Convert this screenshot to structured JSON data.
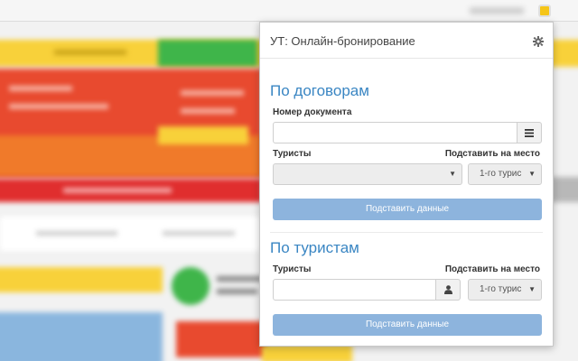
{
  "popup": {
    "title": "УТ: Онлайн-бронирование",
    "contracts_section": {
      "title": "По договорам",
      "doc_number_label": "Номер документа",
      "doc_number_value": "",
      "tourists_label": "Туристы",
      "tourists_value": "",
      "place_label": "Подставить на место",
      "place_value": "1-го турис",
      "submit_label": "Подставить данные"
    },
    "tourists_section": {
      "title": "По туристам",
      "tourists_label": "Туристы",
      "tourists_value": "",
      "place_label": "Подставить на место",
      "place_value": "1-го турис",
      "submit_label": "Подставить данные"
    }
  },
  "colors": {
    "accent": "#3a86c3",
    "button": "#8db4dd",
    "bg_red": "#e84a2f",
    "bg_yellow": "#f8d13a",
    "bg_green": "#3fb54a"
  },
  "icons": {
    "settings": "gear-icon",
    "list": "list-icon",
    "user": "user-icon",
    "caret": "caret-down-icon",
    "extension": "extension-icon"
  }
}
